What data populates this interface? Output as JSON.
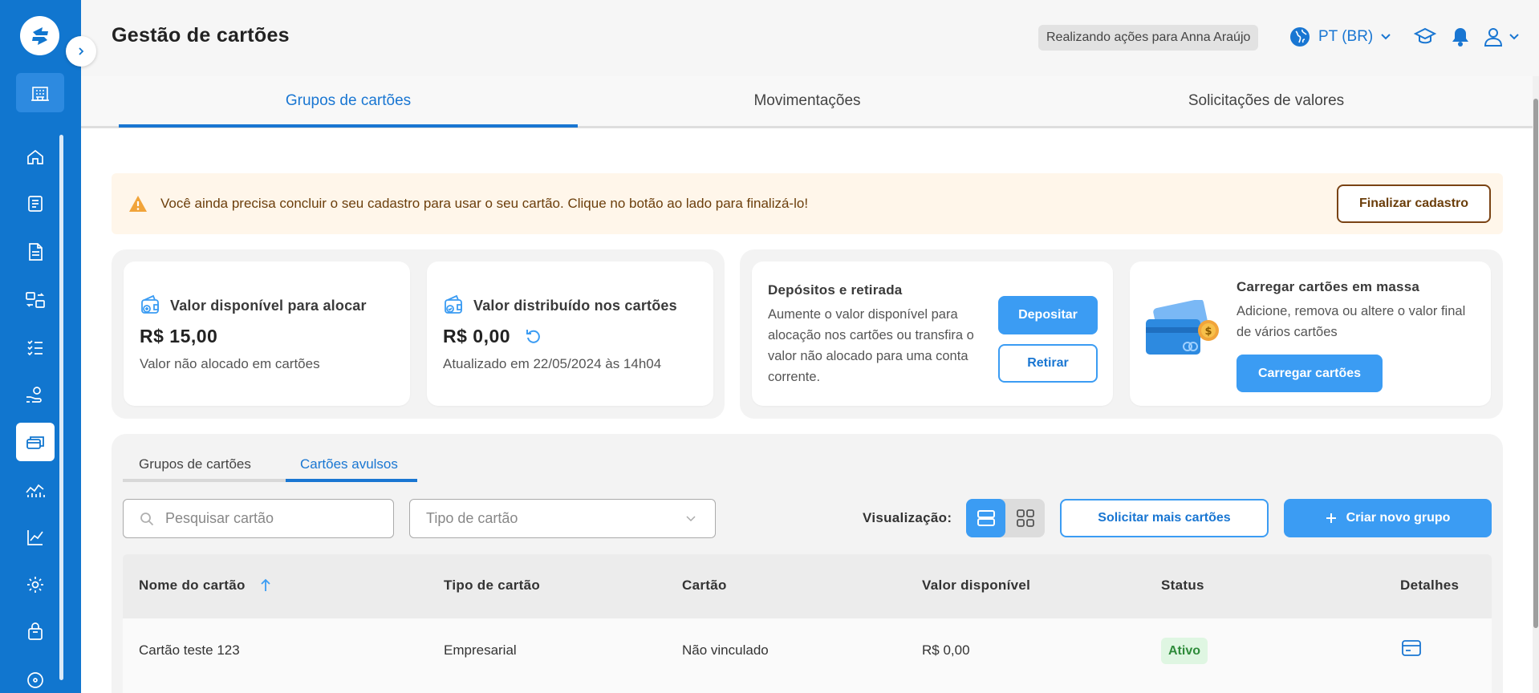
{
  "header": {
    "title": "Gestão de cartões",
    "acting_as": "Realizando ações para Anna Araújo",
    "language": "PT (BR)"
  },
  "icons": {
    "logo": "app-logo-icon",
    "expand": "chevron-right-icon",
    "company": "building-icon",
    "language": "globe-icon",
    "education": "graduation-cap-icon",
    "notifications": "bell-icon",
    "user": "user-icon"
  },
  "sidebar": {
    "items": [
      "home-icon",
      "receipt-icon",
      "document-icon",
      "transfer-icon",
      "list-icon",
      "hand-money-icon",
      "cards-icon",
      "analytics-icon",
      "chart-icon",
      "settings-icon",
      "store-icon",
      "help-icon"
    ],
    "active": "cards-icon"
  },
  "tabs": [
    "Grupos de cartões",
    "Movimentações",
    "Solicitações de valores"
  ],
  "alert": {
    "text": "Você ainda precisa concluir o seu cadastro para usar o seu cartão. Clique no botão ao lado para finalizá-lo!",
    "button": "Finalizar cadastro"
  },
  "balance_cards": {
    "available": {
      "title": "Valor disponível para alocar",
      "value": "R$ 15,00",
      "sub": "Valor não alocado em cartões"
    },
    "distributed": {
      "title": "Valor distribuído nos cartões",
      "value": "R$ 0,00",
      "sub": "Atualizado em 22/05/2024 às 14h04"
    }
  },
  "deposits": {
    "title": "Depósitos e retirada",
    "desc": "Aumente o valor disponível para alocação nos cartões ou transfira o valor não alocado para uma conta corrente.",
    "deposit_btn": "Depositar",
    "withdraw_btn": "Retirar"
  },
  "bulk": {
    "title": "Carregar cartões em massa",
    "desc": "Adicione, remova ou altere o valor final de vários cartões",
    "button": "Carregar cartões"
  },
  "subtabs": [
    "Grupos de cartões",
    "Cartões avulsos"
  ],
  "filters": {
    "search_placeholder": "Pesquisar cartão",
    "type_placeholder": "Tipo de cartão"
  },
  "visualization_label": "Visualização:",
  "actions": {
    "request_more": "Solicitar mais cartões",
    "create_group": "Criar novo grupo"
  },
  "table": {
    "columns": [
      "Nome do cartão",
      "Tipo de cartão",
      "Cartão",
      "Valor disponível",
      "Status",
      "Detalhes"
    ],
    "rows": [
      {
        "name": "Cartão teste 123",
        "type": "Empresarial",
        "card": "Não vinculado",
        "value": "R$ 0,00",
        "status": "Ativo"
      }
    ]
  },
  "colors": {
    "sidebar": "#1176cf",
    "accent": "#1976d2",
    "button": "#3b9cf3",
    "alert_bg": "#fff6ea",
    "success": "#2e8b3a"
  }
}
